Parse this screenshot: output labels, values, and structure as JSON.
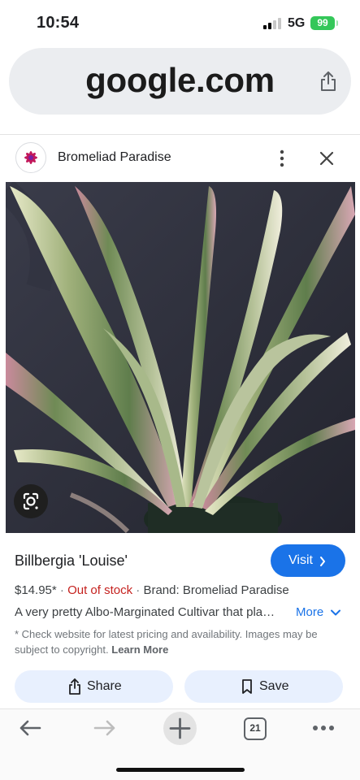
{
  "status_bar": {
    "time": "10:54",
    "network": "5G",
    "battery": "99"
  },
  "browser": {
    "url": "google.com"
  },
  "source": {
    "name": "Bromeliad Paradise"
  },
  "product": {
    "title": "Billbergia 'Louise'",
    "price": "$14.95*",
    "separator": "·",
    "stock_status": "Out of stock",
    "brand": "Brand: Bromeliad Paradise",
    "description": "A very pretty Albo-Marginated Cultivar that plant features white and pink variegated leaves",
    "more_label": "More",
    "disclaimer": "* Check website for latest pricing and availability. Images may be subject to copyright.",
    "learn_more": "Learn More"
  },
  "buttons": {
    "visit": "Visit",
    "share": "Share",
    "save": "Save"
  },
  "toolbar": {
    "tab_count": "21"
  },
  "colors": {
    "accent": "#1a73e8",
    "out_of_stock": "#c5221f",
    "action_bg": "#e8f0fe",
    "url_bar_bg": "#ebedf0",
    "battery": "#34c759"
  },
  "icons": {
    "url_share": "share-icon",
    "header_menu": "more-vertical-icon",
    "header_close": "close-icon",
    "image_search": "lens-icon",
    "visit": "chevron-right-icon",
    "more": "chevron-down-icon",
    "share": "share-icon",
    "save": "bookmark-icon",
    "back": "arrow-left-icon",
    "forward": "arrow-right-icon",
    "new_tab": "plus-icon",
    "tabs": "tabs-icon",
    "menu": "more-horizontal-icon"
  }
}
